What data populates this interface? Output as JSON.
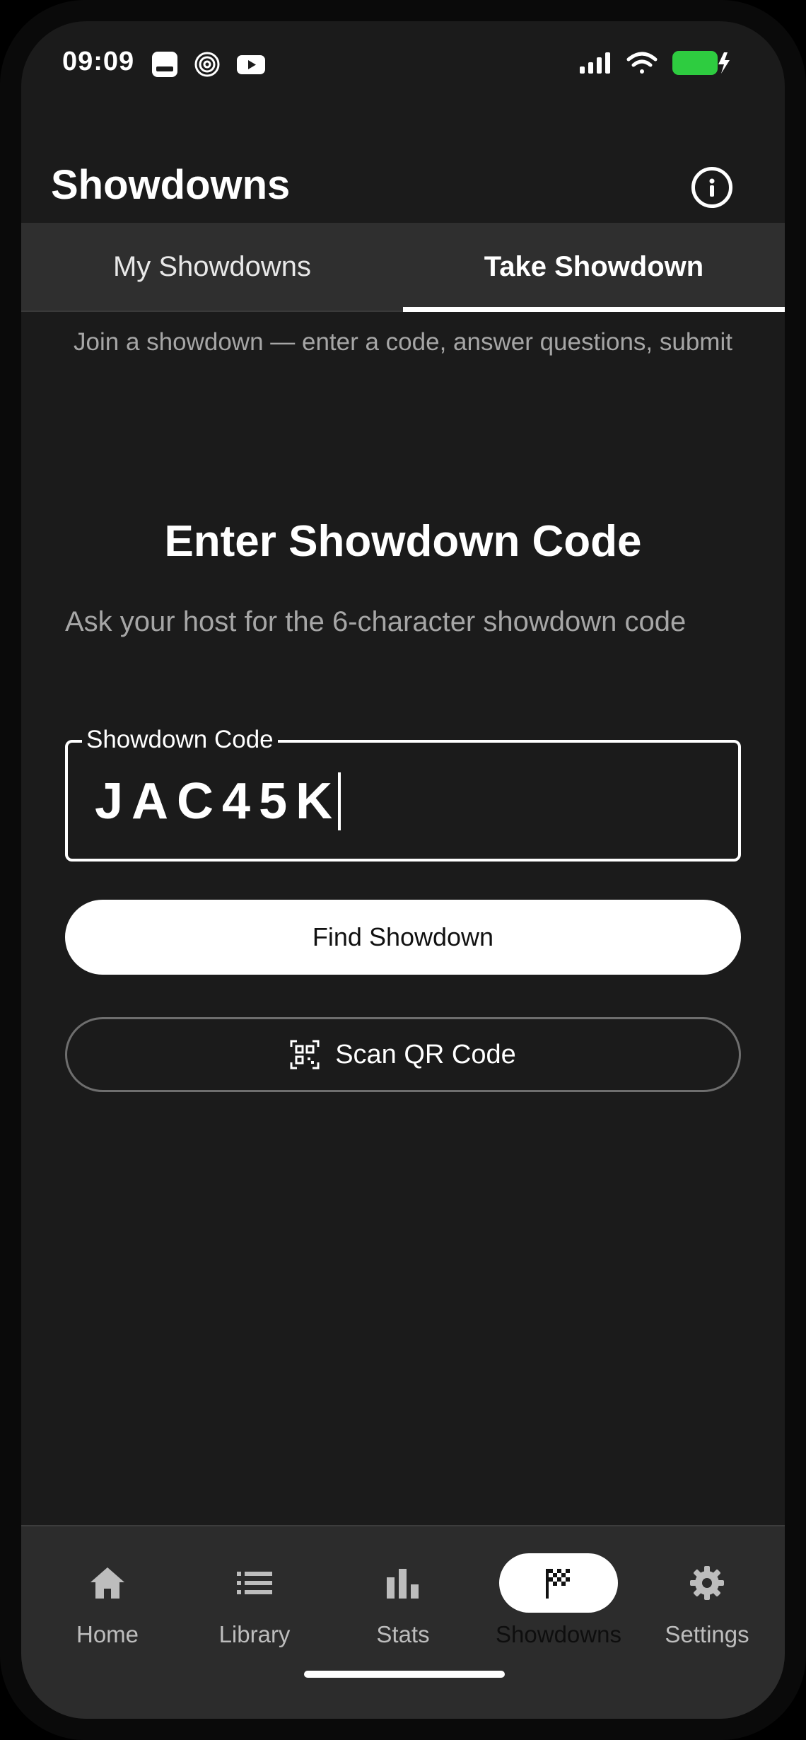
{
  "status_bar": {
    "time": "09:09"
  },
  "header": {
    "title": "Showdowns"
  },
  "tabs": [
    {
      "label": "My Showdowns",
      "active": false
    },
    {
      "label": "Take Showdown",
      "active": true
    }
  ],
  "subtitle": "Join a showdown — enter a code, answer questions, submit",
  "main": {
    "title": "Enter Showdown Code",
    "description": "Ask your host for the 6-character showdown code",
    "code_field": {
      "label": "Showdown Code",
      "value": "JAC45K"
    },
    "find_button": "Find Showdown",
    "scan_button": "Scan QR Code"
  },
  "bottom_nav": {
    "items": [
      {
        "label": "Home",
        "icon": "home-icon",
        "active": false
      },
      {
        "label": "Library",
        "icon": "list-icon",
        "active": false
      },
      {
        "label": "Stats",
        "icon": "bar-chart-icon",
        "active": false
      },
      {
        "label": "Showdowns",
        "icon": "checkered-flag-icon",
        "active": true
      },
      {
        "label": "Settings",
        "icon": "gear-icon",
        "active": false
      }
    ]
  },
  "colors": {
    "background": "#1b1b1b",
    "tab_bar": "#2f2f2f",
    "nav_bar": "#2c2c2c",
    "muted_text": "#a6a6a6",
    "battery": "#2ecc40",
    "primary_button": "#ffffff"
  }
}
